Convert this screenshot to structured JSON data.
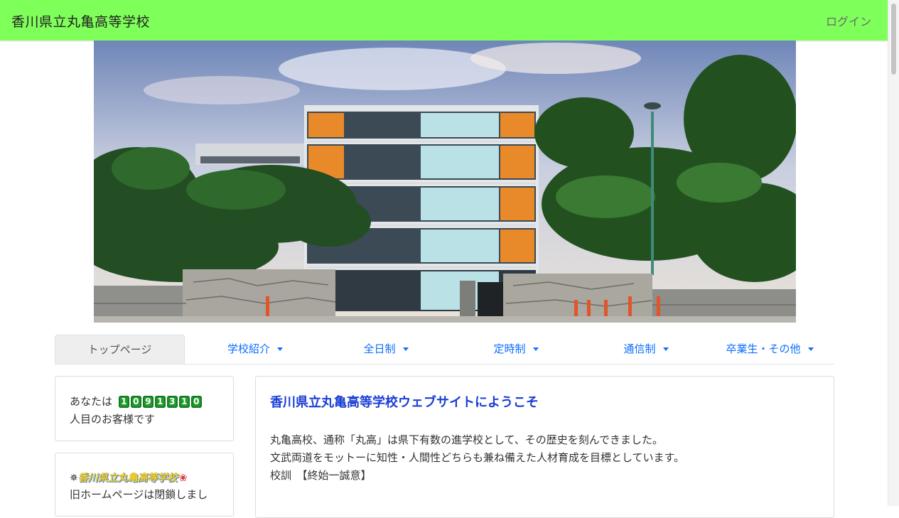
{
  "header": {
    "site_title": "香川県立丸亀高等学校",
    "login_label": "ログイン",
    "bg_color": "#7fff5a"
  },
  "hero": {
    "image": "school-building-photo"
  },
  "nav": {
    "tabs": [
      {
        "label": "トップページ",
        "active": true,
        "dropdown": false
      },
      {
        "label": "学校紹介",
        "dropdown": true
      },
      {
        "label": "全日制",
        "dropdown": true
      },
      {
        "label": "定時制",
        "dropdown": true
      },
      {
        "label": "通信制",
        "dropdown": true
      },
      {
        "label": "卒業生・その他",
        "dropdown": true
      }
    ]
  },
  "counter": {
    "prefix": "あなたは",
    "digits": [
      "1",
      "0",
      "9",
      "1",
      "3",
      "1",
      "0"
    ],
    "suffix": "人目のお客様です"
  },
  "notice": {
    "banner_mark": "✵",
    "banner_name": "香川県立丸亀高等学校",
    "banner_flower": "❀",
    "text": "旧ホームページは閉鎖しまし"
  },
  "main": {
    "title": "香川県立丸亀高等学校ウェブサイトにようこそ",
    "lines": [
      "丸亀高校、通称「丸高」は県下有数の進学校として、その歴史を刻んできました。",
      "文武両道をモットーに知性・人間性どちらも兼ね備えた人材育成を目標としています。",
      "校訓　【終始一誠意】"
    ]
  }
}
